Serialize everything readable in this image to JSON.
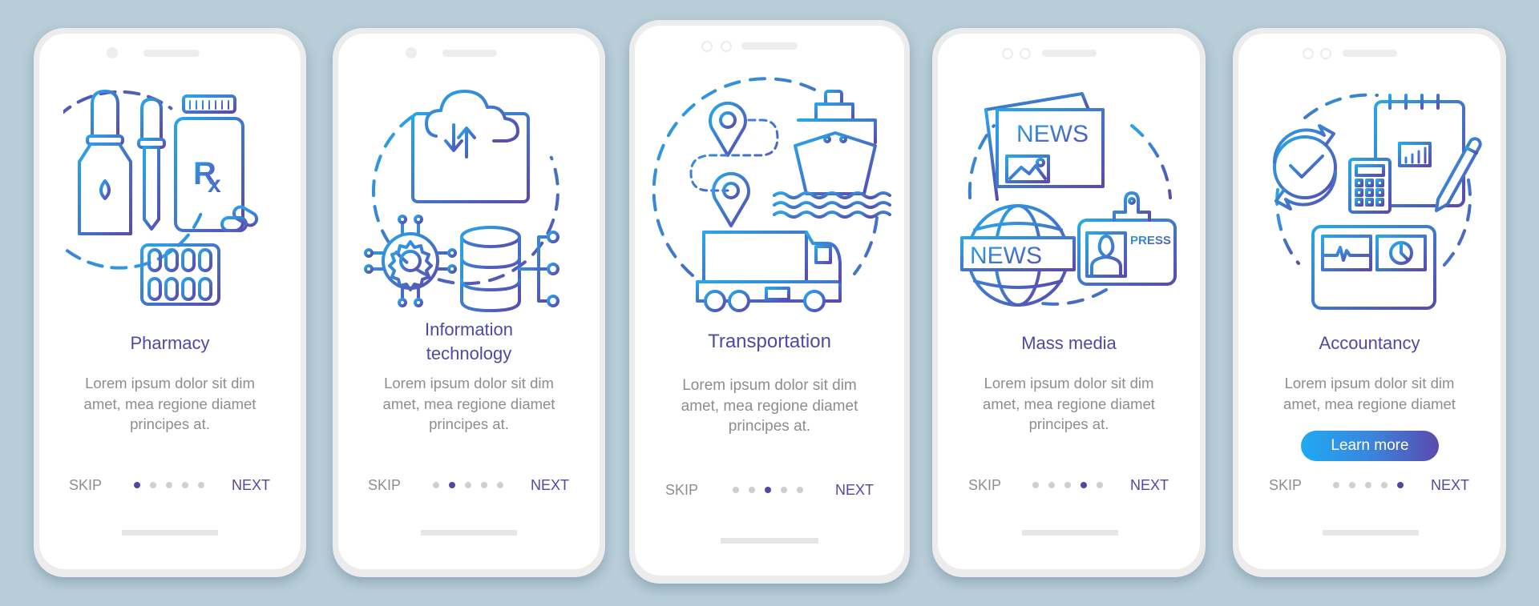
{
  "background_color": "#b7cdd8",
  "accent_gradient": [
    "#27a6ea",
    "#5a4aae"
  ],
  "title_color": "#4f49a3",
  "body_color": "#8d8d8d",
  "screens": [
    {
      "illustration": "pharmacy-icon",
      "title_lines": [
        "Pharmacy"
      ],
      "body_lines": [
        "Lorem ipsum dolor sit dim",
        "amet, mea regione diamet",
        "principes at."
      ],
      "skip_label": "SKIP",
      "next_label": "NEXT",
      "page_count": 5,
      "active_page": 1
    },
    {
      "illustration": "information-technology-icon",
      "title_lines": [
        "Information",
        "technology"
      ],
      "body_lines": [
        "Lorem ipsum dolor sit dim",
        "amet, mea regione diamet",
        "principes at."
      ],
      "skip_label": "SKIP",
      "next_label": "NEXT",
      "page_count": 5,
      "active_page": 2
    },
    {
      "illustration": "transportation-icon",
      "title_lines": [
        "Transportation"
      ],
      "body_lines": [
        "Lorem ipsum dolor sit dim",
        "amet, mea regione diamet",
        "principes at."
      ],
      "skip_label": "SKIP",
      "next_label": "NEXT",
      "page_count": 5,
      "active_page": 3
    },
    {
      "illustration": "mass-media-icon",
      "title_lines": [
        "Mass media"
      ],
      "body_lines": [
        "Lorem ipsum dolor sit dim",
        "amet, mea regione diamet",
        "principes at."
      ],
      "skip_label": "SKIP",
      "next_label": "NEXT",
      "page_count": 5,
      "active_page": 4,
      "news_text": "NEWS",
      "globe_text": "NEWS",
      "badge_text": "PRESS"
    },
    {
      "illustration": "accountancy-icon",
      "title_lines": [
        "Accountancy"
      ],
      "body_lines": [
        "Lorem ipsum dolor sit dim",
        "amet, mea regione diamet"
      ],
      "button_label": "Learn more",
      "skip_label": "SKIP",
      "next_label": "NEXT",
      "page_count": 5,
      "active_page": 5
    }
  ]
}
